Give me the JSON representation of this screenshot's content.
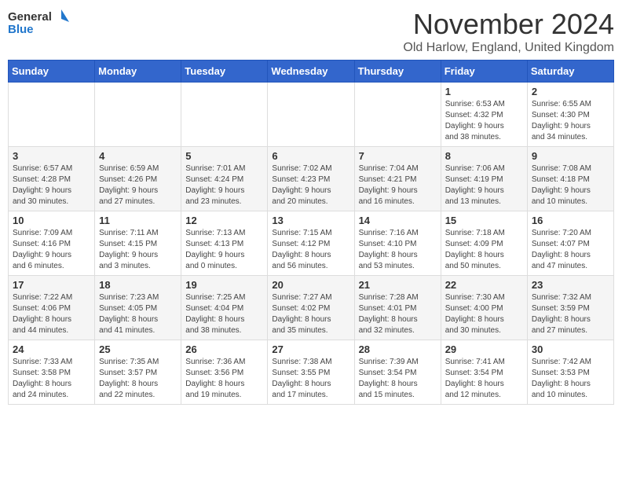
{
  "header": {
    "logo_general": "General",
    "logo_blue": "Blue",
    "month_title": "November 2024",
    "location": "Old Harlow, England, United Kingdom"
  },
  "weekdays": [
    "Sunday",
    "Monday",
    "Tuesday",
    "Wednesday",
    "Thursday",
    "Friday",
    "Saturday"
  ],
  "weeks": [
    [
      {
        "day": "",
        "info": ""
      },
      {
        "day": "",
        "info": ""
      },
      {
        "day": "",
        "info": ""
      },
      {
        "day": "",
        "info": ""
      },
      {
        "day": "",
        "info": ""
      },
      {
        "day": "1",
        "info": "Sunrise: 6:53 AM\nSunset: 4:32 PM\nDaylight: 9 hours\nand 38 minutes."
      },
      {
        "day": "2",
        "info": "Sunrise: 6:55 AM\nSunset: 4:30 PM\nDaylight: 9 hours\nand 34 minutes."
      }
    ],
    [
      {
        "day": "3",
        "info": "Sunrise: 6:57 AM\nSunset: 4:28 PM\nDaylight: 9 hours\nand 30 minutes."
      },
      {
        "day": "4",
        "info": "Sunrise: 6:59 AM\nSunset: 4:26 PM\nDaylight: 9 hours\nand 27 minutes."
      },
      {
        "day": "5",
        "info": "Sunrise: 7:01 AM\nSunset: 4:24 PM\nDaylight: 9 hours\nand 23 minutes."
      },
      {
        "day": "6",
        "info": "Sunrise: 7:02 AM\nSunset: 4:23 PM\nDaylight: 9 hours\nand 20 minutes."
      },
      {
        "day": "7",
        "info": "Sunrise: 7:04 AM\nSunset: 4:21 PM\nDaylight: 9 hours\nand 16 minutes."
      },
      {
        "day": "8",
        "info": "Sunrise: 7:06 AM\nSunset: 4:19 PM\nDaylight: 9 hours\nand 13 minutes."
      },
      {
        "day": "9",
        "info": "Sunrise: 7:08 AM\nSunset: 4:18 PM\nDaylight: 9 hours\nand 10 minutes."
      }
    ],
    [
      {
        "day": "10",
        "info": "Sunrise: 7:09 AM\nSunset: 4:16 PM\nDaylight: 9 hours\nand 6 minutes."
      },
      {
        "day": "11",
        "info": "Sunrise: 7:11 AM\nSunset: 4:15 PM\nDaylight: 9 hours\nand 3 minutes."
      },
      {
        "day": "12",
        "info": "Sunrise: 7:13 AM\nSunset: 4:13 PM\nDaylight: 9 hours\nand 0 minutes."
      },
      {
        "day": "13",
        "info": "Sunrise: 7:15 AM\nSunset: 4:12 PM\nDaylight: 8 hours\nand 56 minutes."
      },
      {
        "day": "14",
        "info": "Sunrise: 7:16 AM\nSunset: 4:10 PM\nDaylight: 8 hours\nand 53 minutes."
      },
      {
        "day": "15",
        "info": "Sunrise: 7:18 AM\nSunset: 4:09 PM\nDaylight: 8 hours\nand 50 minutes."
      },
      {
        "day": "16",
        "info": "Sunrise: 7:20 AM\nSunset: 4:07 PM\nDaylight: 8 hours\nand 47 minutes."
      }
    ],
    [
      {
        "day": "17",
        "info": "Sunrise: 7:22 AM\nSunset: 4:06 PM\nDaylight: 8 hours\nand 44 minutes."
      },
      {
        "day": "18",
        "info": "Sunrise: 7:23 AM\nSunset: 4:05 PM\nDaylight: 8 hours\nand 41 minutes."
      },
      {
        "day": "19",
        "info": "Sunrise: 7:25 AM\nSunset: 4:04 PM\nDaylight: 8 hours\nand 38 minutes."
      },
      {
        "day": "20",
        "info": "Sunrise: 7:27 AM\nSunset: 4:02 PM\nDaylight: 8 hours\nand 35 minutes."
      },
      {
        "day": "21",
        "info": "Sunrise: 7:28 AM\nSunset: 4:01 PM\nDaylight: 8 hours\nand 32 minutes."
      },
      {
        "day": "22",
        "info": "Sunrise: 7:30 AM\nSunset: 4:00 PM\nDaylight: 8 hours\nand 30 minutes."
      },
      {
        "day": "23",
        "info": "Sunrise: 7:32 AM\nSunset: 3:59 PM\nDaylight: 8 hours\nand 27 minutes."
      }
    ],
    [
      {
        "day": "24",
        "info": "Sunrise: 7:33 AM\nSunset: 3:58 PM\nDaylight: 8 hours\nand 24 minutes."
      },
      {
        "day": "25",
        "info": "Sunrise: 7:35 AM\nSunset: 3:57 PM\nDaylight: 8 hours\nand 22 minutes."
      },
      {
        "day": "26",
        "info": "Sunrise: 7:36 AM\nSunset: 3:56 PM\nDaylight: 8 hours\nand 19 minutes."
      },
      {
        "day": "27",
        "info": "Sunrise: 7:38 AM\nSunset: 3:55 PM\nDaylight: 8 hours\nand 17 minutes."
      },
      {
        "day": "28",
        "info": "Sunrise: 7:39 AM\nSunset: 3:54 PM\nDaylight: 8 hours\nand 15 minutes."
      },
      {
        "day": "29",
        "info": "Sunrise: 7:41 AM\nSunset: 3:54 PM\nDaylight: 8 hours\nand 12 minutes."
      },
      {
        "day": "30",
        "info": "Sunrise: 7:42 AM\nSunset: 3:53 PM\nDaylight: 8 hours\nand 10 minutes."
      }
    ]
  ]
}
